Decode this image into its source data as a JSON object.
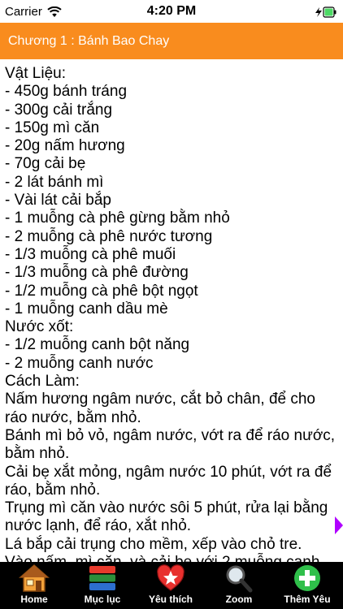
{
  "status_bar": {
    "carrier": "Carrier",
    "time": "4:20 PM",
    "icons": [
      "wifi-icon",
      "battery-icon"
    ]
  },
  "nav": {
    "title": "Chương 1 : Bánh Bao Chay",
    "color": "#f98c1e"
  },
  "content": {
    "lines": [
      "Vật Liệu:",
      "- 450g bánh tráng",
      "- 300g cải trắng",
      "- 150g mì căn",
      "- 20g nấm hương",
      "- 70g cải bẹ",
      "- 2 lát bánh mì",
      "- Vài lát cải bắp",
      "- 1 muỗng cà phê gừng bằm nhỏ",
      "- 2 muỗng cà phê nước tương",
      "- 1/3 muỗng cà phê muối",
      "- 1/3 muỗng cà phê đường",
      "- 1/2 muỗng cà phê bột ngọt",
      "- 1 muỗng canh dầu mè",
      "Nước xốt:",
      "- 1/2 muỗng canh bột năng",
      "- 2 muỗng canh nước",
      "Cách Làm:"
    ],
    "paragraphs": [
      "Nấm hương ngâm nước, cắt bỏ chân, để cho ráo nước, bằm nhỏ.",
      "Bánh mì bỏ vỏ, ngâm nước, vớt ra để ráo nước, bằm nhỏ.",
      "Cải bẹ xắt mỏng, ngâm nước 10 phút, vớt ra để ráo, bằm nhỏ.",
      "Trụng mì căn vào nước sôi 5 phút, rửa lại bằng nước lạnh, để ráo, xắt nhỏ.",
      "Lá bắp cải trụng cho mềm, xếp vào chỏ tre.",
      "Vào nấm, mì căn, và cải bẹ với 2 muỗng canh"
    ]
  },
  "tab_bar": {
    "items": [
      {
        "label": "Home",
        "icon": "home-icon"
      },
      {
        "label": "Mục lục",
        "icon": "list-icon"
      },
      {
        "label": "Yêu thích",
        "icon": "star-icon"
      },
      {
        "label": "Zoom",
        "icon": "magnifier-icon"
      },
      {
        "label": "Thêm Yêu",
        "icon": "plus-icon"
      }
    ]
  },
  "colors": {
    "accent": "#f98c1e",
    "next_arrow": "#b000ff",
    "battery": "#4cd964",
    "tab_bar": "#000000"
  }
}
